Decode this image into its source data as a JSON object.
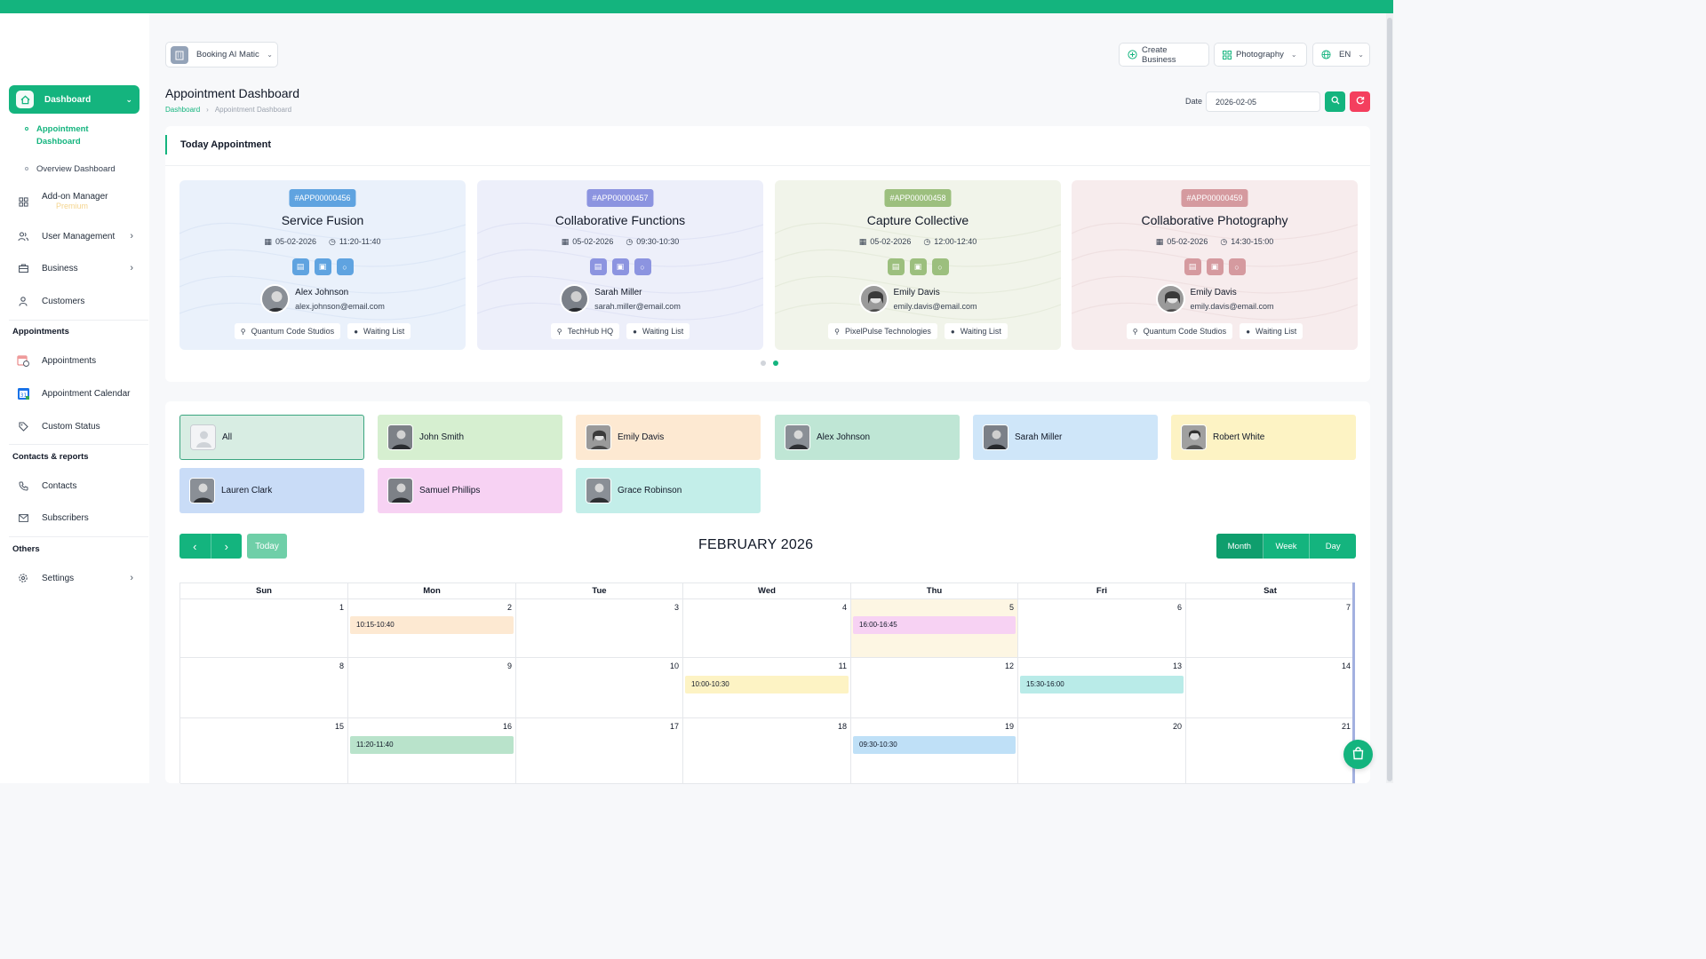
{
  "header": {
    "brand": "Booking AI Matic",
    "create_business": "Create Business",
    "business_type": "Photography",
    "language": "EN",
    "page_title": "Appointment Dashboard",
    "breadcrumb": [
      "Dashboard",
      "Appointment Dashboard"
    ],
    "date_label": "Date",
    "date_value": "2026-02-05"
  },
  "sidebar": {
    "dashboard": "Dashboard",
    "sub_items": [
      "Appointment Dashboard",
      "Overview Dashboard"
    ],
    "addon_manager": "Add-on Manager",
    "premium": "Premium",
    "user_management": "User Management",
    "business": "Business",
    "customers": "Customers",
    "section_appointments": "Appointments",
    "appointments": "Appointments",
    "appointment_calendar": "Appointment Calendar",
    "custom_status": "Custom Status",
    "section_contacts": "Contacts & reports",
    "contacts": "Contacts",
    "subscribers": "Subscribers",
    "section_others": "Others",
    "settings": "Settings"
  },
  "today": {
    "heading": "Today Appointment",
    "cards": [
      {
        "id": "#APP00000456",
        "title": "Service Fusion",
        "date": "05-02-2026",
        "time": "11:20-11:40",
        "name": "Alex Johnson",
        "email": "alex.johnson@email.com",
        "location": "Quantum Code Studios",
        "status": "Waiting List"
      },
      {
        "id": "#APP00000457",
        "title": "Collaborative Functions",
        "date": "05-02-2026",
        "time": "09:30-10:30",
        "name": "Sarah Miller",
        "email": "sarah.miller@email.com",
        "location": "TechHub HQ",
        "status": "Waiting List"
      },
      {
        "id": "#APP00000458",
        "title": "Capture Collective",
        "date": "05-02-2026",
        "time": "12:00-12:40",
        "name": "Emily Davis",
        "email": "emily.davis@email.com",
        "location": "PixelPulse Technologies",
        "status": "Waiting List"
      },
      {
        "id": "#APP00000459",
        "title": "Collaborative Photography",
        "date": "05-02-2026",
        "time": "14:30-15:00",
        "name": "Emily Davis",
        "email": "emily.davis@email.com",
        "location": "Quantum Code Studios",
        "status": "Waiting List"
      }
    ]
  },
  "staff": [
    "All",
    "John Smith",
    "Emily Davis",
    "Alex Johnson",
    "Sarah Miller",
    "Robert White",
    "Lauren Clark",
    "Samuel Phillips",
    "Grace Robinson"
  ],
  "calendar": {
    "today_label": "Today",
    "month_title": "FEBRUARY 2026",
    "views": [
      "Month",
      "Week",
      "Day"
    ],
    "weekdays": [
      "Sun",
      "Mon",
      "Tue",
      "Wed",
      "Thu",
      "Fri",
      "Sat"
    ],
    "weeks": [
      [
        "1",
        "2",
        "3",
        "4",
        "5",
        "6",
        "7"
      ],
      [
        "8",
        "9",
        "10",
        "11",
        "12",
        "13",
        "14"
      ],
      [
        "15",
        "16",
        "17",
        "18",
        "19",
        "20",
        "21"
      ]
    ],
    "events": [
      "10:15-10:40",
      "16:00-16:45",
      "10:00-10:30",
      "15:30-16:00",
      "11:20-11:40",
      "09:30-10:30"
    ]
  },
  "colors": {
    "accent": "#14b47e",
    "danger": "#f43f5e"
  }
}
